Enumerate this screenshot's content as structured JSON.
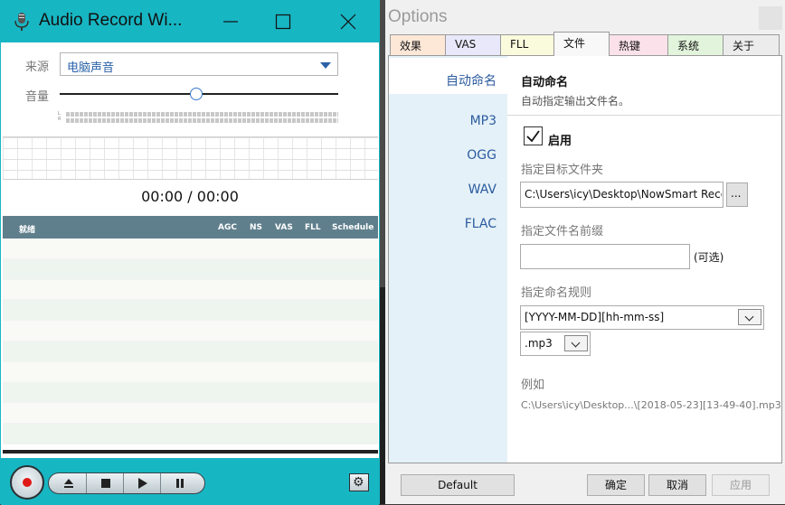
{
  "recorder": {
    "title": "Audio Record Wi...",
    "source_label": "来源",
    "source_value": "电脑声音",
    "volume_label": "音量",
    "volume_level": 0.49,
    "meter_labels": [
      "L",
      "R"
    ],
    "time": "00:00 / 00:00",
    "table_headers": [
      "就绪",
      "AGC",
      "NS",
      "VAS",
      "FLL",
      "Schedule"
    ],
    "icons": {
      "app": "microphone-icon",
      "minimize": "minimize-icon",
      "maximize": "maximize-icon",
      "close": "close-icon",
      "record": "record-icon",
      "eject": "eject-icon",
      "stop": "stop-icon",
      "play": "play-icon",
      "pause": "pause-icon",
      "settings": "gear-icon"
    },
    "colors": {
      "accent": "#17b6c3",
      "record": "#e01818",
      "table_header": "#5f7f8c"
    }
  },
  "options": {
    "title": "Options",
    "tabs": [
      {
        "label": "效果",
        "color": "#fde8d8"
      },
      {
        "label": "VAS",
        "color": "#e8e8fa"
      },
      {
        "label": "FLL",
        "color": "#fafadc"
      },
      {
        "label": "文件",
        "color": "#f8f8f8"
      },
      {
        "label": "热键",
        "color": "#fbe2ea"
      },
      {
        "label": "系统",
        "color": "#e2f5dc"
      },
      {
        "label": "关于",
        "color": "#ececec"
      }
    ],
    "nav": [
      "自动命名",
      "MP3",
      "OGG",
      "WAV",
      "FLAC"
    ],
    "section_title": "自动命名",
    "section_desc": "自动指定输出文件名。",
    "enable_label": "启用",
    "enable_checked": true,
    "folder_label": "指定目标文件夹",
    "folder_value": "C:\\Users\\icy\\Desktop\\NowSmart Reco",
    "browse_label": "...",
    "prefix_label": "指定文件名前缀",
    "prefix_value": "",
    "prefix_hint": "(可选)",
    "rule_label": "指定命名规则",
    "rule_value": "[YYYY-MM-DD][hh-mm-ss]",
    "ext_value": ".mp3",
    "example_label": "例如",
    "example_value": "C:\\Users\\icy\\Desktop...\\[2018-05-23][13-49-40].mp3",
    "buttons": {
      "default": "Default",
      "ok": "确定",
      "cancel": "取消",
      "apply": "应用"
    }
  }
}
